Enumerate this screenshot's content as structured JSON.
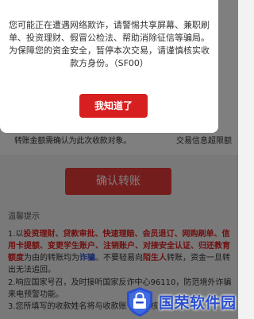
{
  "background": {
    "form_row": {
      "hint": "转账金额需确认为此次收款对象。",
      "link_1": "交易信息",
      "link_2": "超限额"
    },
    "confirm_button": "确认转账",
    "tips_title": "温馨提示",
    "tips": {
      "tip1_a": "1.以",
      "tip1_red_1": "投资理财、贷款审批、快速理赔、会员退订、网购刷单、信用卡提额、变更学生账户、注销账户、对接安全认证、归还教育额度",
      "tip1_b": "为由的转账均为",
      "tip1_blue_1": "诈骗",
      "tip1_c": "。不要轻易向",
      "tip1_red_2": "陌生人",
      "tip1_d": "转账，资金一旦转出无法追回。",
      "tip2": "2.响应国家号召，及时接听国家反诈中心96110，防范境外诈骗来电预警功能。",
      "tip3": "3.您所填写的收款姓名将与收款账号进行核验。"
    }
  },
  "dialog": {
    "message": "您可能正在遭遇网络欺诈，请警惕共享屏幕、兼职刷单、投资理财、假冒公检法、帮助消除征信等骗局。为保障您的资金安全，暂停本次交易，请谨慎核实收款方身份。（SF00）",
    "confirm_label": "我知道了"
  },
  "watermark": {
    "text": "国荣软件园",
    "logo_icon": "shield-shopping-bag-logo"
  },
  "colors": {
    "accent_red": "#d81f1f",
    "highlight_blue": "#2a4fcf",
    "overlay": "rgba(0,0,0,0.5)"
  }
}
